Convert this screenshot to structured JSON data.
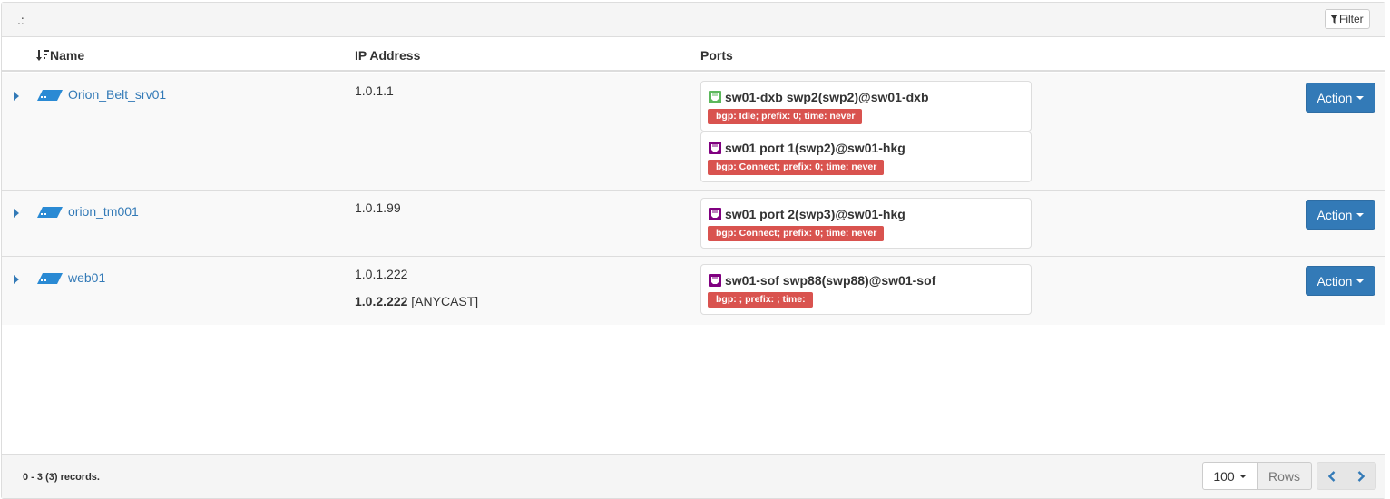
{
  "panel": {
    "title": ".:",
    "filter_label": "Filter"
  },
  "columns": {
    "name": "Name",
    "ip": "IP Address",
    "ports": "Ports"
  },
  "rows": [
    {
      "name": "Orion_Belt_srv01",
      "ips": [
        "1.0.1.1"
      ],
      "ports": [
        {
          "title": "sw01-dxb swp2(swp2)@sw01-dxb",
          "badge": "bgp: Idle; prefix: 0; time: never",
          "icon": "port-icon-green",
          "icon_color": "#5cb85c"
        },
        {
          "title": "sw01 port 1(swp2)@sw01-hkg",
          "badge": "bgp: Connect; prefix: 0; time: never",
          "icon": "port-icon-purple",
          "icon_color": "#800080"
        }
      ],
      "action_label": "Action"
    },
    {
      "name": "orion_tm001",
      "ips": [
        "1.0.1.99"
      ],
      "ports": [
        {
          "title": "sw01 port 2(swp3)@sw01-hkg",
          "badge": "bgp: Connect; prefix: 0; time: never",
          "icon": "port-icon-purple",
          "icon_color": "#800080"
        }
      ],
      "action_label": "Action"
    },
    {
      "name": "web01",
      "ips": [
        "1.0.1.222"
      ],
      "anycast_ip": "1.0.2.222",
      "anycast_tag": "[ANYCAST]",
      "ports": [
        {
          "title": "sw01-sof swp88(swp88)@sw01-sof",
          "badge": "bgp: ; prefix: ; time:",
          "icon": "port-icon-purple",
          "icon_color": "#800080"
        }
      ],
      "action_label": "Action"
    }
  ],
  "footer": {
    "records": "0 - 3 (3) records.",
    "rows_value": "100",
    "rows_label": "Rows"
  },
  "colors": {
    "primary": "#337ab7",
    "danger": "#d9534f",
    "link": "#337ab7",
    "device_icon": "#2a8ad4"
  }
}
